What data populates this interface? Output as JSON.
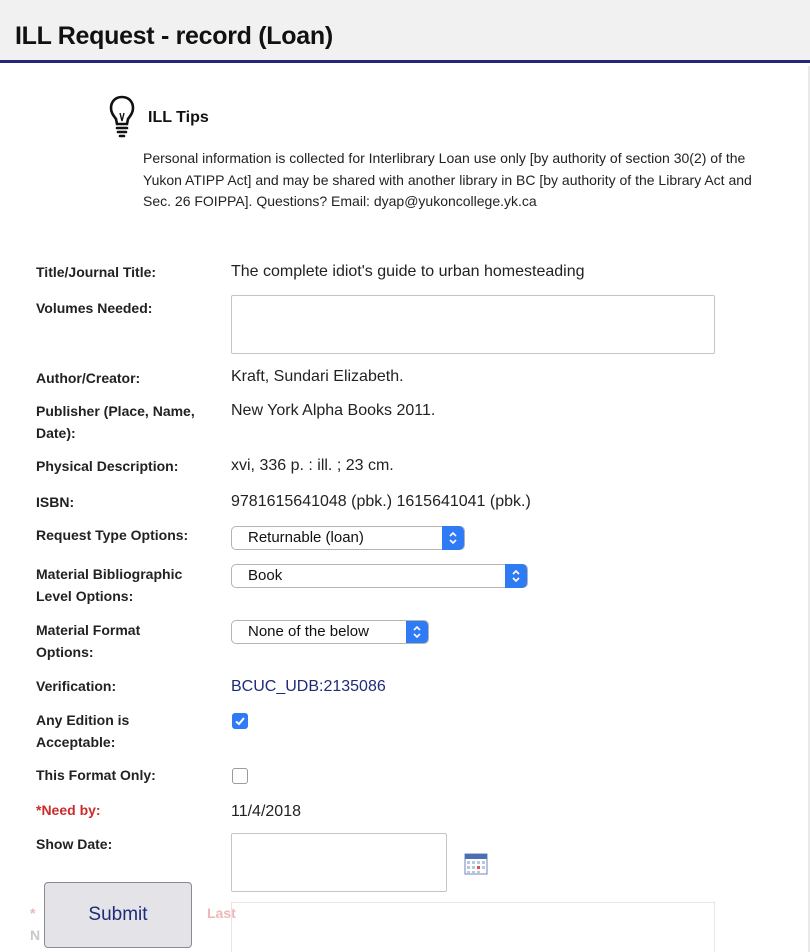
{
  "header": {
    "title": "ILL Request - record (Loan)"
  },
  "tips": {
    "title": "ILL Tips",
    "text": "Personal information is collected for Interlibrary Loan use only [by authority of section 30(2) of the Yukon ATIPP Act] and may be shared with another library in BC [by authority of the Library Act and Sec. 26 FOIPPA]. Questions? Email: dyap@yukoncollege.yk.ca"
  },
  "form": {
    "title": {
      "label": "Title/Journal Title:",
      "value": "The complete idiot's guide to urban homesteading"
    },
    "volumes": {
      "label": "Volumes Needed:",
      "value": ""
    },
    "author": {
      "label": "Author/Creator:",
      "value": "Kraft, Sundari Elizabeth."
    },
    "publisher": {
      "label_line1": "Publisher (Place, Name,",
      "label_line2": "Date):",
      "value": "New York Alpha Books 2011."
    },
    "physical": {
      "label": "Physical Description:",
      "value": "xvi, 336 p. : ill. ; 23 cm."
    },
    "isbn": {
      "label": "ISBN:",
      "value": "9781615641048 (pbk.) 1615641041 (pbk.)"
    },
    "request_type": {
      "label": "Request Type Options:",
      "selected": "Returnable (loan)"
    },
    "bib_level": {
      "label_line1": "Material Bibliographic",
      "label_line2": "Level Options:",
      "selected": "Book"
    },
    "material_format": {
      "label_line1": "Material Format",
      "label_line2": "Options:",
      "selected": "None of the below"
    },
    "verification": {
      "label": "Verification:",
      "value": "BCUC_UDB:2135086"
    },
    "any_edition": {
      "label_line1": "Any Edition is",
      "label_line2": "Acceptable:",
      "checked": true
    },
    "format_only": {
      "label": "This Format Only:",
      "checked": false
    },
    "need_by": {
      "label": "*Need by:",
      "value": "11/4/2018"
    },
    "show_date": {
      "label": "Show Date:",
      "value": ""
    },
    "partial_label": {
      "line1": "*",
      "line1_end": "Last",
      "line2": "N"
    }
  },
  "submit": {
    "label": "Submit"
  },
  "colors": {
    "header_rule": "#27277a",
    "link": "#1f2a7a",
    "required": "#cc2b2b",
    "control_blue": "#2f7bf5"
  }
}
